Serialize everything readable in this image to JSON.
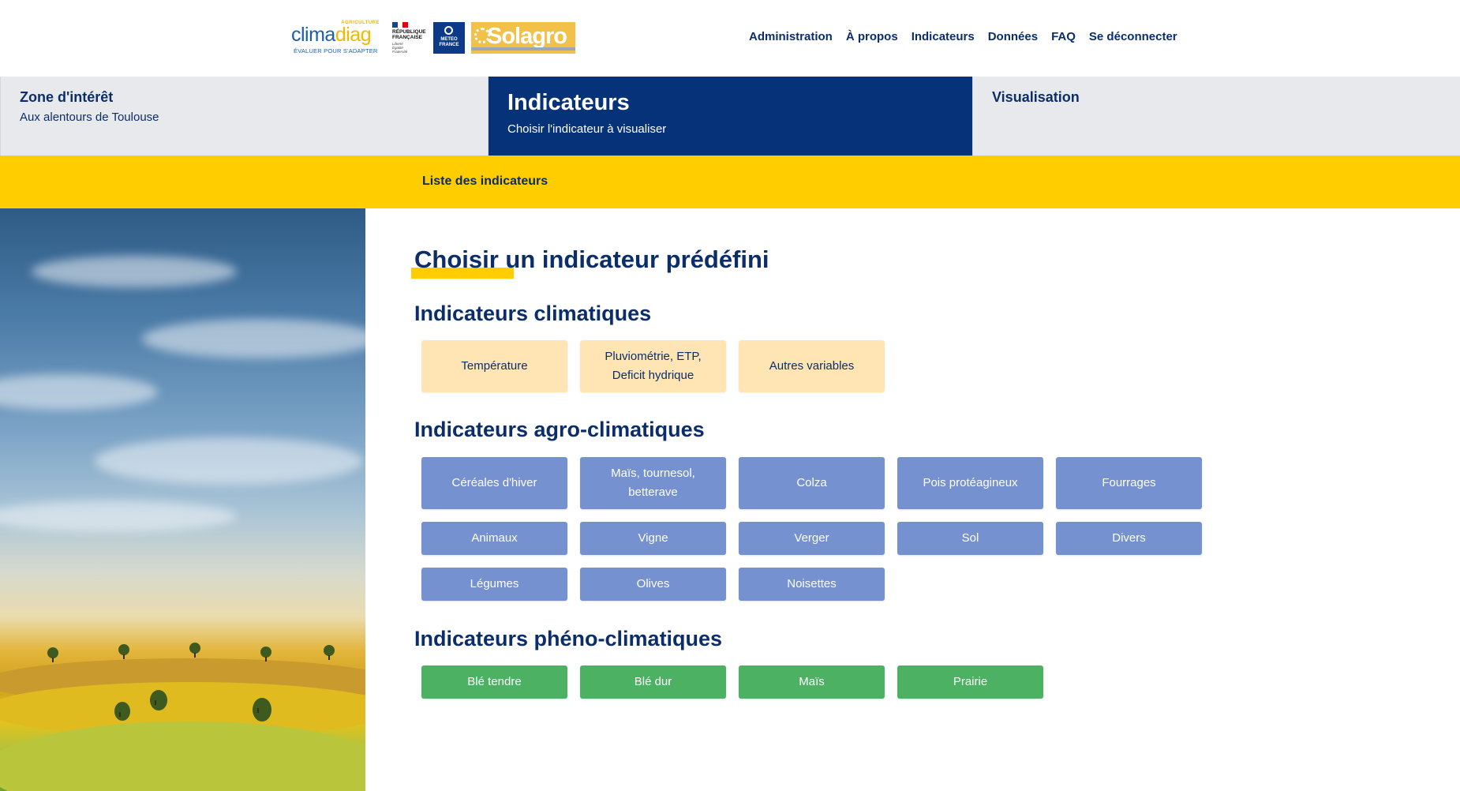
{
  "header": {
    "logos": {
      "climadiag_top": "AGRICULTURE",
      "climadiag_word_1": "clima",
      "climadiag_word_2": "diag",
      "climadiag_tag": "ÉVALUER POUR S'ADAPTER",
      "rf_title": "RÉPUBLIQUE FRANÇAISE",
      "rf_motto": "Liberté Égalité Fraternité",
      "meteo_france": "METEO FRANCE",
      "solagro": "Solagro"
    },
    "nav": [
      "Administration",
      "À propos",
      "Indicateurs",
      "Données",
      "FAQ",
      "Se déconnecter"
    ]
  },
  "steps": [
    {
      "title": "Zone d'intérêt",
      "subtitle": "Aux alentours de Toulouse"
    },
    {
      "title": "Indicateurs",
      "subtitle": "Choisir l'indicateur à visualiser"
    },
    {
      "title": "Visualisation",
      "subtitle": ""
    }
  ],
  "subnav": {
    "label": "Liste des indicateurs"
  },
  "main": {
    "title": "Choisir un indicateur prédéfini",
    "sections": {
      "climatiques": {
        "title": "Indicateurs climatiques",
        "buttons": [
          "Température",
          "Pluviométrie, ETP, Deficit hydrique",
          "Autres variables"
        ]
      },
      "agro": {
        "title": "Indicateurs agro-climatiques",
        "buttons": [
          "Céréales d'hiver",
          "Maïs, tournesol, betterave",
          "Colza",
          "Pois protéagineux",
          "Fourrages",
          "Animaux",
          "Vigne",
          "Verger",
          "Sol",
          "Divers",
          "Légumes",
          "Olives",
          "Noisettes"
        ]
      },
      "pheno": {
        "title": "Indicateurs phéno-climatiques",
        "buttons": [
          "Blé tendre",
          "Blé dur",
          "Maïs",
          "Prairie"
        ]
      }
    }
  },
  "colors": {
    "navy": "#0b2e6b",
    "active_step": "#06327a",
    "yellow": "#ffcd00",
    "climatique_btn": "#ffe5b3",
    "agro_btn": "#7591cf",
    "pheno_btn": "#4cb163"
  }
}
